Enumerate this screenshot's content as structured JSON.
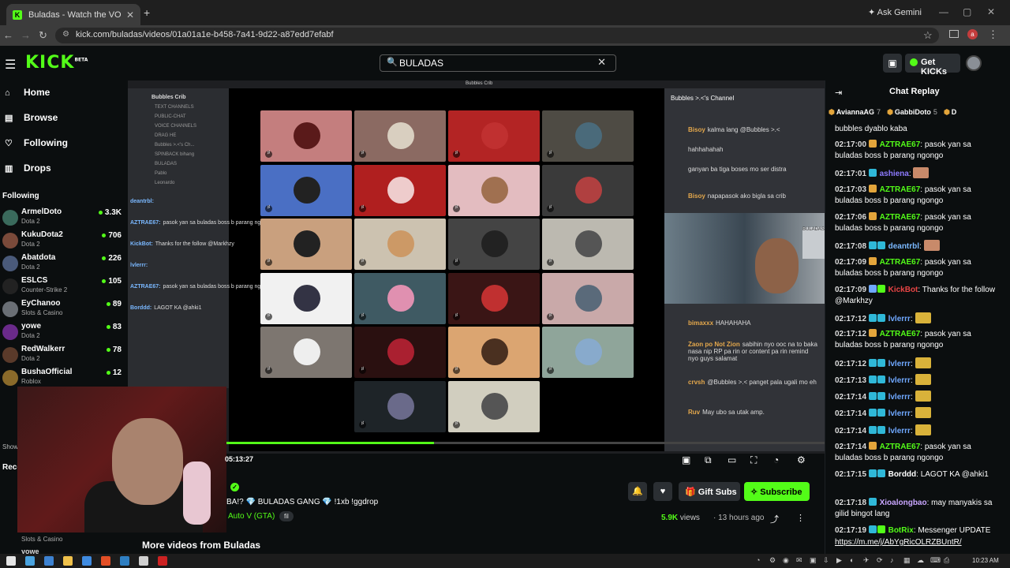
{
  "browser": {
    "tab_title": "Buladas - Watch the VOD on K",
    "ask_gemini": "Ask Gemini",
    "url": "kick.com/buladas/videos/01a01a1e-b458-7a41-9d22-a87edd7efabf",
    "profile_initial": "a"
  },
  "header": {
    "logo": "KICK",
    "logo_tag": "BETA",
    "search_value": "BULADAS",
    "get_kicks": "Get KICKs"
  },
  "sidebar": {
    "nav": [
      "Home",
      "Browse",
      "Following",
      "Drops"
    ],
    "following_label": "Following",
    "channels": [
      {
        "name": "ArmelDoto",
        "game": "Dota 2",
        "viewers": "3.3K",
        "color": "#3a6a5c"
      },
      {
        "name": "KukuDota2",
        "game": "Dota 2",
        "viewers": "706",
        "color": "#7a4a3a"
      },
      {
        "name": "Abatdota",
        "game": "Dota 2",
        "viewers": "226",
        "color": "#4a5a7a"
      },
      {
        "name": "ESLCS",
        "game": "Counter-Strike 2",
        "viewers": "105",
        "color": "#222222"
      },
      {
        "name": "EyChanoo",
        "game": "Slots & Casino",
        "viewers": "89",
        "color": "#6a6f75"
      },
      {
        "name": "yowe",
        "game": "Dota 2",
        "viewers": "83",
        "color": "#6a2a8a"
      },
      {
        "name": "RedWalkerr",
        "game": "Dota 2",
        "viewers": "78",
        "color": "#5a3a2a"
      },
      {
        "name": "BushaOfficial",
        "game": "Roblox",
        "viewers": "12",
        "color": "#8a6a2a"
      }
    ],
    "show_more": "Show",
    "recommended": "Reco",
    "rec_game": "Slots & Casino",
    "rec_name": "yowe"
  },
  "player": {
    "discord_server": "Bubbles Crib",
    "discord_lines": [
      "TEXT CHANNELS",
      "PUBLIC-CHAT",
      "VOICE CHANNELS",
      "DRAG HE",
      "Bubbles >.<'s Ch...",
      "SPINBACK bihang",
      "BULADAS",
      "Pablo",
      "Leonardo"
    ],
    "overlay_chat": [
      {
        "user": "deantrbl:",
        "text": ""
      },
      {
        "user": "AZTRAE67:",
        "text": "pasok yan sa buladas boss b parang ngongo"
      },
      {
        "user": "KickBot:",
        "text": "Thanks for the follow @Markhzy"
      },
      {
        "user": "lvlerrr:",
        "text": ""
      },
      {
        "user": "AZTRAE67:",
        "text": "pasok yan sa buladas boss b parang ngongo"
      },
      {
        "user": "Borddd:",
        "text": "LAGOT KA @ahki1"
      }
    ],
    "right_channel": "Bubbles >.<'s Channel",
    "right_msgs": [
      {
        "user": "Bisoy",
        "text": "kalma lang @Bubbles >.<"
      },
      {
        "user": "",
        "text": "hahhahahah"
      },
      {
        "user": "",
        "text": "ganyan ba tiga boses mo ser distra"
      },
      {
        "user": "Bisoy",
        "text": "napapasok ako bigla sa crib"
      },
      {
        "user": "bimaxxx",
        "text": "HAHAHAHA"
      },
      {
        "user": "Zaon po Not Zion",
        "text": "sabihin nyo ooc na to baka nasa nip RP pa rin or content pa rin remind nyo guys salamat"
      },
      {
        "user": "crvsh",
        "text": "@Bubbles >.< panget pala ugali mo eh"
      },
      {
        "user": "Ruv",
        "text": "May ubo sa utak amp."
      }
    ],
    "cam_sign": "BULADAS",
    "progress": 0.347,
    "timecode": "05:13:27"
  },
  "stream": {
    "title": "BA!? 💎 BULADAS GANG 💎 !1xb !ggdrop",
    "category": "Auto V (GTA)",
    "language": "fil",
    "gift_subs": "Gift Subs",
    "subscribe": "Subscribe",
    "views": "5.9K",
    "views_label": "views",
    "ago": "13 hours ago",
    "more_videos": "More videos from Buladas"
  },
  "chat": {
    "title": "Chat Replay",
    "gifters": [
      {
        "name": "AviannaAG",
        "count": "7"
      },
      {
        "name": "GabbiDoto",
        "count": "5"
      },
      {
        "name": "D",
        "count": ""
      }
    ],
    "messages": [
      {
        "time": "",
        "user": "",
        "color": "#ffffff",
        "text": "bubbles dyablo kaba"
      },
      {
        "time": "02:17:00",
        "user": "AZTRAE67",
        "color": "#53fc18",
        "text": "pasok yan sa buladas boss b parang ngongo"
      },
      {
        "time": "02:17:01",
        "user": "ashiena",
        "color": "#8e7bff",
        "text": ""
      },
      {
        "time": "02:17:03",
        "user": "AZTRAE67",
        "color": "#53fc18",
        "text": "pasok yan sa buladas boss b parang ngongo"
      },
      {
        "time": "02:17:06",
        "user": "AZTRAE67",
        "color": "#53fc18",
        "text": "pasok yan sa buladas boss b parang ngongo"
      },
      {
        "time": "02:17:08",
        "user": "deantrbl",
        "color": "#7ab8ff",
        "text": ""
      },
      {
        "time": "02:17:09",
        "user": "AZTRAE67",
        "color": "#53fc18",
        "text": "pasok yan sa buladas boss b parang ngongo"
      },
      {
        "time": "02:17:09",
        "user": "KickBot",
        "color": "#e84545",
        "text": "Thanks for the follow @Markhzy"
      },
      {
        "time": "02:17:12",
        "user": "lvlerrr",
        "color": "#6fa8ff",
        "text": ""
      },
      {
        "time": "02:17:12",
        "user": "AZTRAE67",
        "color": "#53fc18",
        "text": "pasok yan sa buladas boss b parang ngongo"
      },
      {
        "time": "02:17:12",
        "user": "lvlerrr",
        "color": "#6fa8ff",
        "text": ""
      },
      {
        "time": "02:17:13",
        "user": "lvlerrr",
        "color": "#6fa8ff",
        "text": ""
      },
      {
        "time": "02:17:14",
        "user": "lvlerrr",
        "color": "#6fa8ff",
        "text": ""
      },
      {
        "time": "02:17:14",
        "user": "lvlerrr",
        "color": "#6fa8ff",
        "text": ""
      },
      {
        "time": "02:17:14",
        "user": "lvlerrr",
        "color": "#6fa8ff",
        "text": ""
      },
      {
        "time": "02:17:14",
        "user": "AZTRAE67",
        "color": "#53fc18",
        "text": "pasok yan sa buladas boss b parang ngongo"
      },
      {
        "time": "02:17:15",
        "user": "Borddd",
        "color": "#ffffff",
        "text": "LAGOT KA @ahki1"
      },
      {
        "time": "02:17:18",
        "user": "Xioalongbao",
        "color": "#c9a6ff",
        "text": "may manyakis sa gilid bingot lang"
      },
      {
        "time": "02:17:19",
        "user": "BotRix",
        "color": "#53fc18",
        "text": "Messenger UPDATE"
      }
    ],
    "botrix_link": "https://m.me/j/AbYgRicOLRZBUntR/"
  },
  "taskbar": {
    "time": "10:23 AM"
  }
}
